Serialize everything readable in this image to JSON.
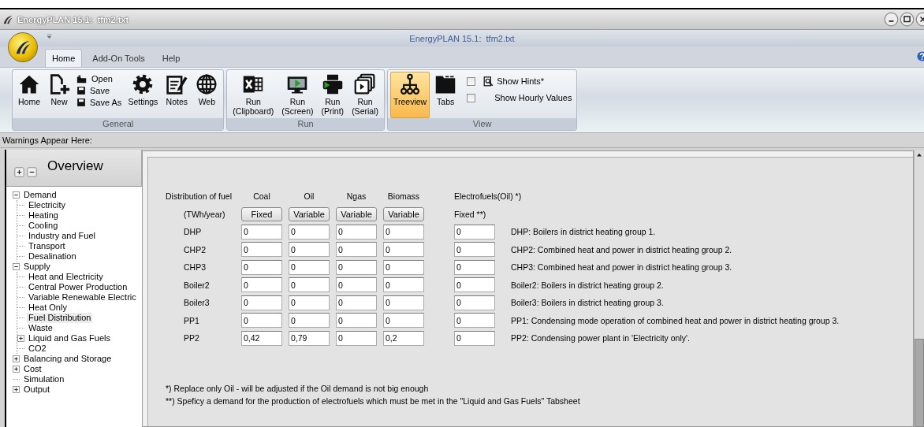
{
  "window": {
    "title": "EnergyPLAN 15.1:  tfm2.txt"
  },
  "ribbon": {
    "title": "EnergyPLAN 15.1:  tfm2.txt",
    "tabs": [
      {
        "label": "Home",
        "selected": true
      },
      {
        "label": "Add-On Tools",
        "selected": false
      },
      {
        "label": "Help",
        "selected": false
      }
    ],
    "groups": [
      {
        "label": "General",
        "items": [
          {
            "kind": "large",
            "label": "Home"
          },
          {
            "kind": "large",
            "label": "New"
          },
          {
            "kind": "small",
            "label": "Open"
          },
          {
            "kind": "small",
            "label": "Save"
          },
          {
            "kind": "small",
            "label": "Save As"
          },
          {
            "kind": "large",
            "label": "Settings"
          },
          {
            "kind": "large",
            "label": "Notes"
          },
          {
            "kind": "large",
            "label": "Web"
          }
        ]
      },
      {
        "label": "Run",
        "items": [
          {
            "kind": "large",
            "label": "Run\n(Clipboard)"
          },
          {
            "kind": "large",
            "label": "Run\n(Screen)"
          },
          {
            "kind": "large",
            "label": "Run\n(Print)"
          },
          {
            "kind": "large",
            "label": "Run\n(Serial)"
          }
        ]
      },
      {
        "label": "View",
        "items": [
          {
            "kind": "large",
            "label": "Treeview",
            "selected": true
          },
          {
            "kind": "large",
            "label": "Tabs",
            "selected": false
          },
          {
            "kind": "check",
            "label": "Show Hints*",
            "checked": false
          },
          {
            "kind": "check",
            "label": "Show Hourly Values",
            "checked": false
          }
        ]
      }
    ]
  },
  "warnings": "Warnings Appear Here:",
  "sidebar": {
    "title": "Overview",
    "items": [
      {
        "label": "Demand",
        "expanded": true,
        "selected": false,
        "children": [
          {
            "label": "Electricity",
            "selected": false
          },
          {
            "label": "Heating",
            "selected": false
          },
          {
            "label": "Cooling",
            "selected": false
          },
          {
            "label": "Industry and Fuel",
            "selected": false
          },
          {
            "label": "Transport",
            "selected": false
          },
          {
            "label": "Desalination",
            "selected": false
          }
        ]
      },
      {
        "label": "Supply",
        "expanded": true,
        "selected": false,
        "children": [
          {
            "label": "Heat and Electricity",
            "selected": false
          },
          {
            "label": "Central Power Production",
            "selected": false
          },
          {
            "label": "Variable Renewable Electric",
            "selected": false
          },
          {
            "label": "Heat Only",
            "selected": false
          },
          {
            "label": "Fuel Distribution",
            "selected": true
          },
          {
            "label": "Waste",
            "selected": false
          },
          {
            "label": "Liquid and Gas Fuels",
            "expanded": false,
            "selected": false
          },
          {
            "label": "CO2",
            "selected": false
          }
        ]
      },
      {
        "label": "Balancing and Storage",
        "expanded": false,
        "selected": false
      },
      {
        "label": "Cost",
        "expanded": false,
        "selected": false
      },
      {
        "label": "Simulation",
        "selected": false
      },
      {
        "label": "Output",
        "expanded": false,
        "selected": false
      }
    ]
  },
  "fuel_distribution": {
    "heading": "Distribution of fuel",
    "unit": "(TWh/year)",
    "fuels": [
      {
        "name": "Coal",
        "mode": "Fixed"
      },
      {
        "name": "Oil",
        "mode": "Variable"
      },
      {
        "name": "Ngas",
        "mode": "Variable"
      },
      {
        "name": "Biomass",
        "mode": "Variable"
      }
    ],
    "electrofuels": {
      "name": "Electrofuels(Oil) *)",
      "mode": "Fixed **)"
    },
    "rows": [
      {
        "label": "DHP",
        "values": [
          "0",
          "0",
          "0",
          "0"
        ],
        "electrofuels": "0",
        "description": "DHP: Boilers in district heating group 1."
      },
      {
        "label": "CHP2",
        "values": [
          "0",
          "0",
          "0",
          "0"
        ],
        "electrofuels": "0",
        "description": "CHP2: Combined heat and power in district heating group 2."
      },
      {
        "label": "CHP3",
        "values": [
          "0",
          "0",
          "0",
          "0"
        ],
        "electrofuels": "0",
        "description": "CHP3: Combined heat and power in district heating group 3."
      },
      {
        "label": "Boiler2",
        "values": [
          "0",
          "0",
          "0",
          "0"
        ],
        "electrofuels": "0",
        "description": "Boiler2: Boilers in district heating group 2."
      },
      {
        "label": "Boiler3",
        "values": [
          "0",
          "0",
          "0",
          "0"
        ],
        "electrofuels": "0",
        "description": "Boiler3: Boilers in district heating group 3."
      },
      {
        "label": "PP1",
        "values": [
          "0",
          "0",
          "0",
          "0"
        ],
        "electrofuels": "0",
        "description": "PP1: Condensing mode operation of combined heat and power in district heating group 3."
      },
      {
        "label": "PP2",
        "values": [
          "0,42",
          "0,79",
          "0",
          "0,2"
        ],
        "electrofuels": "0",
        "description": "PP2: Condensing power plant in 'Electricity only'."
      }
    ],
    "notes": [
      "*) Replace only Oil - will be adjusted if the Oil demand is not big enough",
      "**) Speficy a demand for the production of electrofuels which must be met in the \"Liquid and Gas Fuels\" Tabsheet"
    ]
  }
}
